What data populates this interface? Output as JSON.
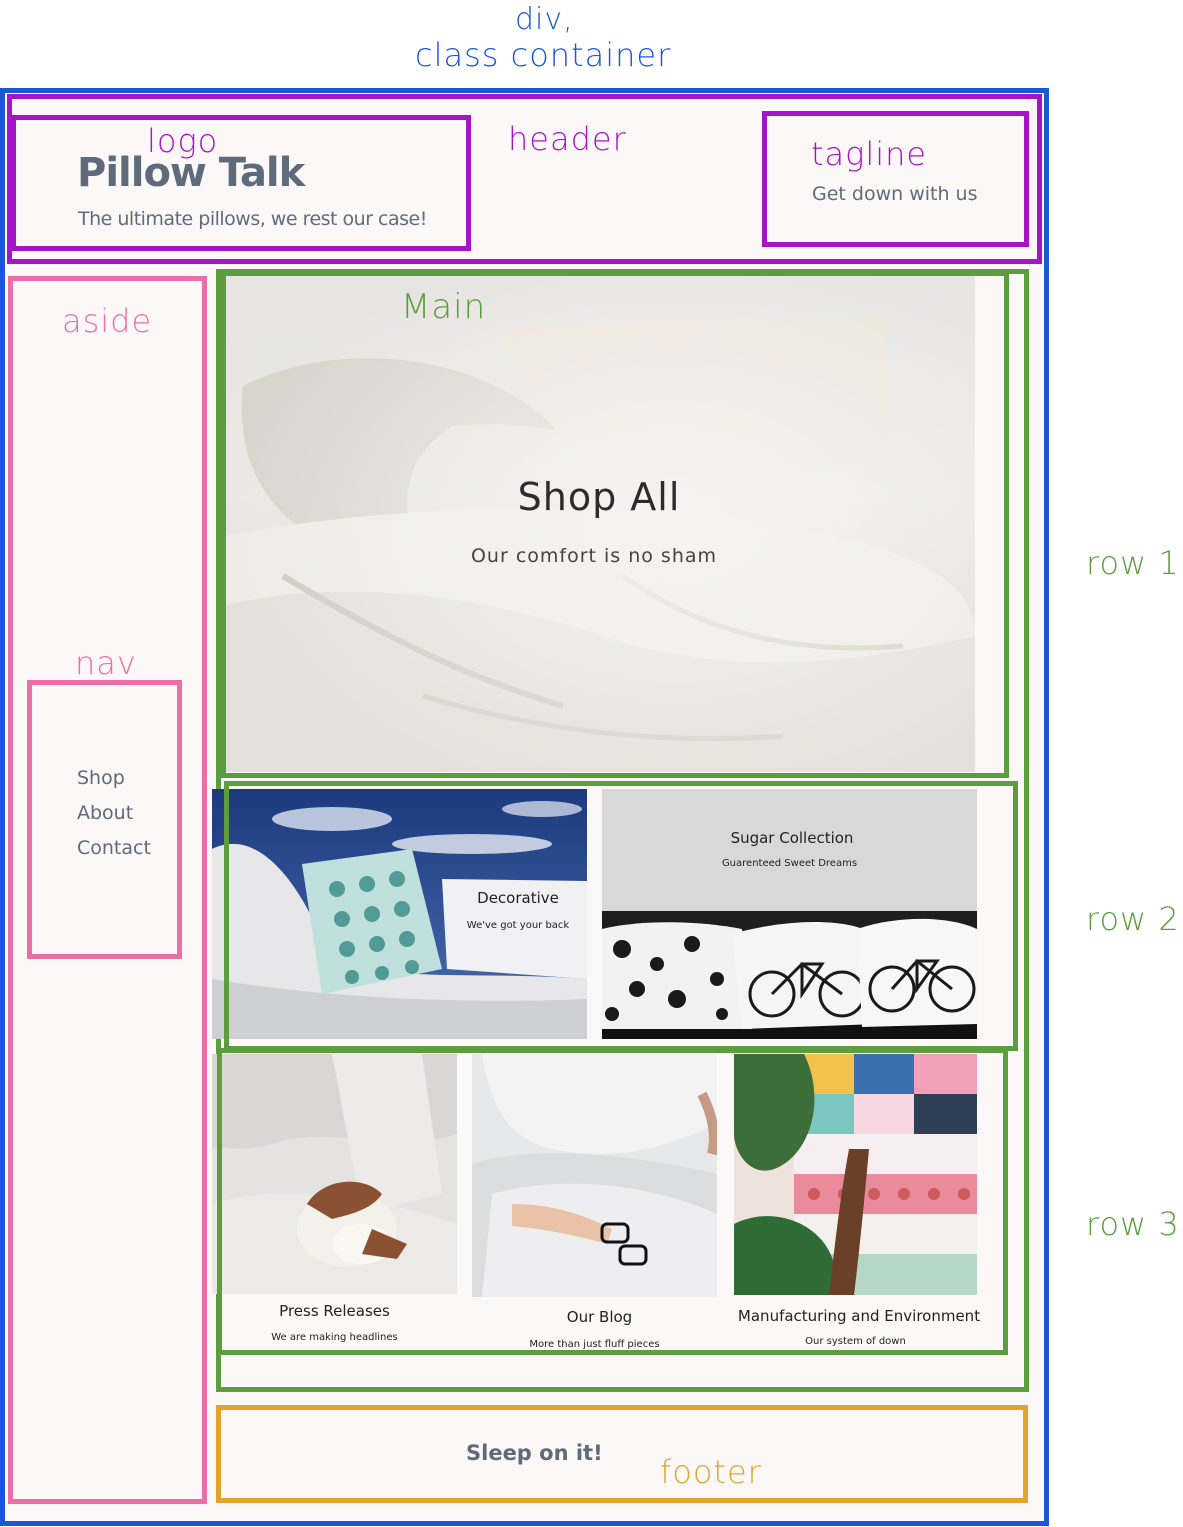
{
  "annotations": {
    "container": "div,",
    "container_class": "class container",
    "logo": "logo",
    "header": "header",
    "tagline": "tagline",
    "aside": "aside",
    "main": "Main",
    "nav": "nav",
    "row1": "row 1",
    "row2": "row 2",
    "row3": "row 3",
    "footer": "footer"
  },
  "site": {
    "logo_title": "Pillow Talk",
    "logo_subtitle": "The ultimate pillows, we rest our case!",
    "tagline": "Get down with us",
    "nav": [
      "Shop",
      "About",
      "Contact"
    ],
    "hero_title": "Shop All",
    "hero_subtitle": "Our comfort is no sham",
    "decorative_title": "Decorative",
    "decorative_subtitle": "We've got your back",
    "sugar_title": "Sugar Collection",
    "sugar_subtitle": "Guarenteed Sweet Dreams",
    "press_title": "Press Releases",
    "press_subtitle": "We are making headlines",
    "blog_title": "Our Blog",
    "blog_subtitle": "More than just fluff pieces",
    "manufacturing_title": "Manufacturing and Environment",
    "manufacturing_subtitle": "Our system of down",
    "footer": "Sleep on it!"
  },
  "colors": {
    "container": "#1a56d6",
    "header": "#a614c8",
    "aside": "#ec6ea6",
    "main": "#5c9e3f",
    "footer": "#e3a32c",
    "site_text": "#5f6b7a"
  }
}
